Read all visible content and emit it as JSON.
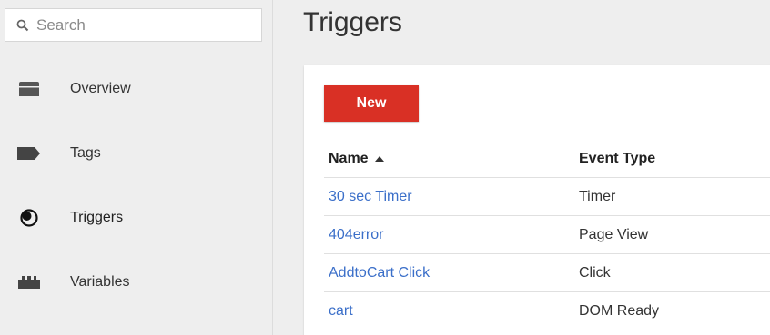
{
  "search": {
    "placeholder": "Search",
    "icon": "search-icon"
  },
  "sidebar": {
    "items": [
      {
        "label": "Overview",
        "icon": "overview-icon",
        "active": false
      },
      {
        "label": "Tags",
        "icon": "tag-icon",
        "active": false
      },
      {
        "label": "Triggers",
        "icon": "trigger-icon",
        "active": true
      },
      {
        "label": "Variables",
        "icon": "variables-icon",
        "active": false
      }
    ]
  },
  "main": {
    "title": "Triggers",
    "new_button": "New",
    "accent_color": "#d93025",
    "link_color": "#3b6fc9",
    "table": {
      "headers": {
        "name": "Name",
        "event_type": "Event Type"
      },
      "sort": {
        "column": "name",
        "direction": "ascending"
      },
      "rows": [
        {
          "name": "30 sec Timer",
          "event_type": "Timer"
        },
        {
          "name": "404error",
          "event_type": "Page View"
        },
        {
          "name": "AddtoCart Click",
          "event_type": "Click"
        },
        {
          "name": "cart",
          "event_type": "DOM Ready"
        }
      ]
    }
  }
}
